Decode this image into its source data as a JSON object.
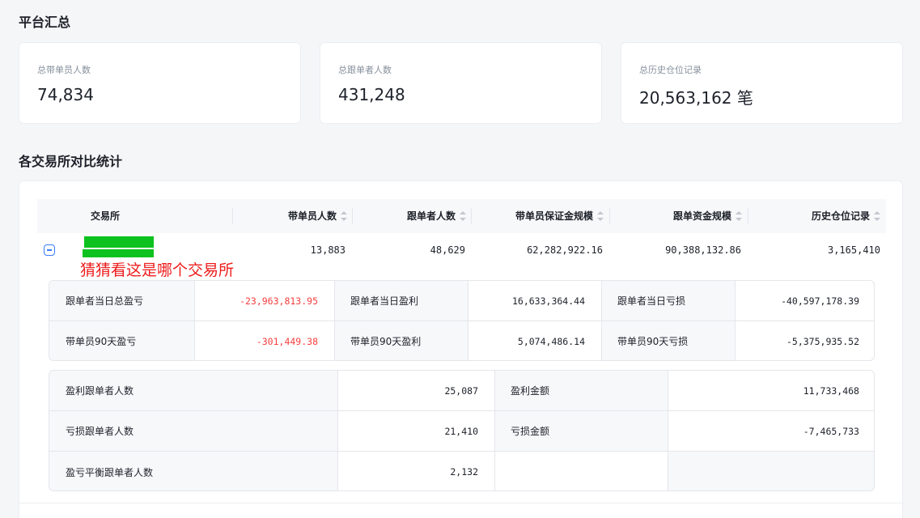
{
  "summary": {
    "title": "平台汇总",
    "cards": [
      {
        "label": "总带单员人数",
        "value": "74,834"
      },
      {
        "label": "总跟单者人数",
        "value": "431,248"
      },
      {
        "label": "总历史仓位记录",
        "value": "20,563,162 笔"
      }
    ]
  },
  "compare": {
    "title": "各交易所对比统计",
    "columns": [
      "交易所",
      "带单员人数",
      "跟单者人数",
      "带单员保证金规模",
      "跟单资金规模",
      "历史仓位记录"
    ],
    "row": {
      "traders": "13,883",
      "followers": "48,629",
      "margin": "62,282,922.16",
      "funds": "90,388,132.86",
      "history": "3,165,410",
      "annotation": "猜猜看这是哪个交易所"
    },
    "pnl": [
      [
        {
          "label": "跟单者当日总盈亏",
          "value": "-23,963,813.95",
          "negative": true
        },
        {
          "label": "跟单者当日盈利",
          "value": "16,633,364.44"
        },
        {
          "label": "跟单者当日亏损",
          "value": "-40,597,178.39"
        }
      ],
      [
        {
          "label": "带单员90天盈亏",
          "value": "-301,449.38",
          "negative": true
        },
        {
          "label": "带单员90天盈利",
          "value": "5,074,486.14"
        },
        {
          "label": "带单员90天亏损",
          "value": "-5,375,935.52"
        }
      ]
    ],
    "followers_stats": [
      {
        "label": "盈利跟单者人数",
        "value": "25,087",
        "label2": "盈利金额",
        "value2": "11,733,468"
      },
      {
        "label": "亏损跟单者人数",
        "value": "21,410",
        "label2": "亏损金额",
        "value2": "-7,465,733"
      },
      {
        "label": "盈亏平衡跟单者人数",
        "value": "2,132"
      }
    ]
  },
  "colors": {
    "accent": "#3a7bff",
    "negative": "#f53f3f",
    "annotation": "#ee1c1c",
    "redaction": "#0dc21f"
  }
}
